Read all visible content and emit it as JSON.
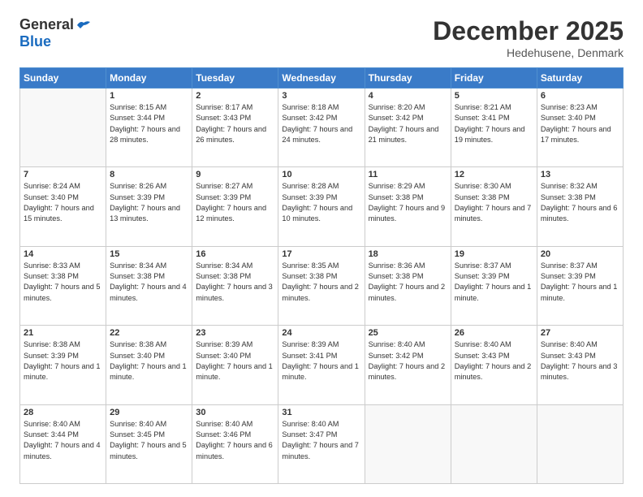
{
  "header": {
    "logo_general": "General",
    "logo_blue": "Blue",
    "month_title": "December 2025",
    "location": "Hedehusene, Denmark"
  },
  "days_of_week": [
    "Sunday",
    "Monday",
    "Tuesday",
    "Wednesday",
    "Thursday",
    "Friday",
    "Saturday"
  ],
  "weeks": [
    [
      {
        "day": "",
        "sunrise": "",
        "sunset": "",
        "daylight": ""
      },
      {
        "day": "1",
        "sunrise": "Sunrise: 8:15 AM",
        "sunset": "Sunset: 3:44 PM",
        "daylight": "Daylight: 7 hours and 28 minutes."
      },
      {
        "day": "2",
        "sunrise": "Sunrise: 8:17 AM",
        "sunset": "Sunset: 3:43 PM",
        "daylight": "Daylight: 7 hours and 26 minutes."
      },
      {
        "day": "3",
        "sunrise": "Sunrise: 8:18 AM",
        "sunset": "Sunset: 3:42 PM",
        "daylight": "Daylight: 7 hours and 24 minutes."
      },
      {
        "day": "4",
        "sunrise": "Sunrise: 8:20 AM",
        "sunset": "Sunset: 3:42 PM",
        "daylight": "Daylight: 7 hours and 21 minutes."
      },
      {
        "day": "5",
        "sunrise": "Sunrise: 8:21 AM",
        "sunset": "Sunset: 3:41 PM",
        "daylight": "Daylight: 7 hours and 19 minutes."
      },
      {
        "day": "6",
        "sunrise": "Sunrise: 8:23 AM",
        "sunset": "Sunset: 3:40 PM",
        "daylight": "Daylight: 7 hours and 17 minutes."
      }
    ],
    [
      {
        "day": "7",
        "sunrise": "Sunrise: 8:24 AM",
        "sunset": "Sunset: 3:40 PM",
        "daylight": "Daylight: 7 hours and 15 minutes."
      },
      {
        "day": "8",
        "sunrise": "Sunrise: 8:26 AM",
        "sunset": "Sunset: 3:39 PM",
        "daylight": "Daylight: 7 hours and 13 minutes."
      },
      {
        "day": "9",
        "sunrise": "Sunrise: 8:27 AM",
        "sunset": "Sunset: 3:39 PM",
        "daylight": "Daylight: 7 hours and 12 minutes."
      },
      {
        "day": "10",
        "sunrise": "Sunrise: 8:28 AM",
        "sunset": "Sunset: 3:39 PM",
        "daylight": "Daylight: 7 hours and 10 minutes."
      },
      {
        "day": "11",
        "sunrise": "Sunrise: 8:29 AM",
        "sunset": "Sunset: 3:38 PM",
        "daylight": "Daylight: 7 hours and 9 minutes."
      },
      {
        "day": "12",
        "sunrise": "Sunrise: 8:30 AM",
        "sunset": "Sunset: 3:38 PM",
        "daylight": "Daylight: 7 hours and 7 minutes."
      },
      {
        "day": "13",
        "sunrise": "Sunrise: 8:32 AM",
        "sunset": "Sunset: 3:38 PM",
        "daylight": "Daylight: 7 hours and 6 minutes."
      }
    ],
    [
      {
        "day": "14",
        "sunrise": "Sunrise: 8:33 AM",
        "sunset": "Sunset: 3:38 PM",
        "daylight": "Daylight: 7 hours and 5 minutes."
      },
      {
        "day": "15",
        "sunrise": "Sunrise: 8:34 AM",
        "sunset": "Sunset: 3:38 PM",
        "daylight": "Daylight: 7 hours and 4 minutes."
      },
      {
        "day": "16",
        "sunrise": "Sunrise: 8:34 AM",
        "sunset": "Sunset: 3:38 PM",
        "daylight": "Daylight: 7 hours and 3 minutes."
      },
      {
        "day": "17",
        "sunrise": "Sunrise: 8:35 AM",
        "sunset": "Sunset: 3:38 PM",
        "daylight": "Daylight: 7 hours and 2 minutes."
      },
      {
        "day": "18",
        "sunrise": "Sunrise: 8:36 AM",
        "sunset": "Sunset: 3:38 PM",
        "daylight": "Daylight: 7 hours and 2 minutes."
      },
      {
        "day": "19",
        "sunrise": "Sunrise: 8:37 AM",
        "sunset": "Sunset: 3:39 PM",
        "daylight": "Daylight: 7 hours and 1 minute."
      },
      {
        "day": "20",
        "sunrise": "Sunrise: 8:37 AM",
        "sunset": "Sunset: 3:39 PM",
        "daylight": "Daylight: 7 hours and 1 minute."
      }
    ],
    [
      {
        "day": "21",
        "sunrise": "Sunrise: 8:38 AM",
        "sunset": "Sunset: 3:39 PM",
        "daylight": "Daylight: 7 hours and 1 minute."
      },
      {
        "day": "22",
        "sunrise": "Sunrise: 8:38 AM",
        "sunset": "Sunset: 3:40 PM",
        "daylight": "Daylight: 7 hours and 1 minute."
      },
      {
        "day": "23",
        "sunrise": "Sunrise: 8:39 AM",
        "sunset": "Sunset: 3:40 PM",
        "daylight": "Daylight: 7 hours and 1 minute."
      },
      {
        "day": "24",
        "sunrise": "Sunrise: 8:39 AM",
        "sunset": "Sunset: 3:41 PM",
        "daylight": "Daylight: 7 hours and 1 minute."
      },
      {
        "day": "25",
        "sunrise": "Sunrise: 8:40 AM",
        "sunset": "Sunset: 3:42 PM",
        "daylight": "Daylight: 7 hours and 2 minutes."
      },
      {
        "day": "26",
        "sunrise": "Sunrise: 8:40 AM",
        "sunset": "Sunset: 3:43 PM",
        "daylight": "Daylight: 7 hours and 2 minutes."
      },
      {
        "day": "27",
        "sunrise": "Sunrise: 8:40 AM",
        "sunset": "Sunset: 3:43 PM",
        "daylight": "Daylight: 7 hours and 3 minutes."
      }
    ],
    [
      {
        "day": "28",
        "sunrise": "Sunrise: 8:40 AM",
        "sunset": "Sunset: 3:44 PM",
        "daylight": "Daylight: 7 hours and 4 minutes."
      },
      {
        "day": "29",
        "sunrise": "Sunrise: 8:40 AM",
        "sunset": "Sunset: 3:45 PM",
        "daylight": "Daylight: 7 hours and 5 minutes."
      },
      {
        "day": "30",
        "sunrise": "Sunrise: 8:40 AM",
        "sunset": "Sunset: 3:46 PM",
        "daylight": "Daylight: 7 hours and 6 minutes."
      },
      {
        "day": "31",
        "sunrise": "Sunrise: 8:40 AM",
        "sunset": "Sunset: 3:47 PM",
        "daylight": "Daylight: 7 hours and 7 minutes."
      },
      {
        "day": "",
        "sunrise": "",
        "sunset": "",
        "daylight": ""
      },
      {
        "day": "",
        "sunrise": "",
        "sunset": "",
        "daylight": ""
      },
      {
        "day": "",
        "sunrise": "",
        "sunset": "",
        "daylight": ""
      }
    ]
  ]
}
